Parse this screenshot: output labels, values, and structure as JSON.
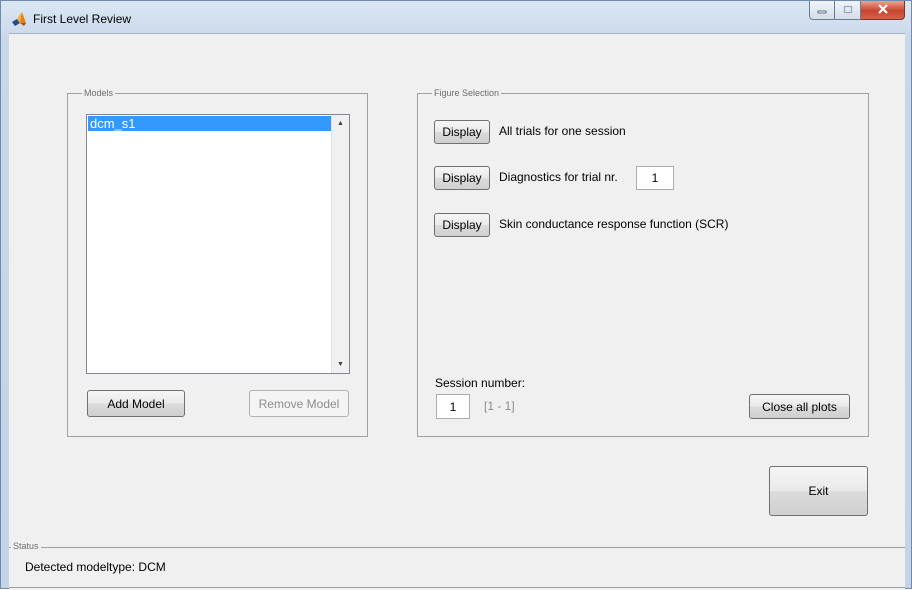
{
  "window": {
    "title": "First Level Review"
  },
  "models": {
    "legend": "Models",
    "items": [
      "dcm_s1"
    ],
    "add_label": "Add Model",
    "remove_label": "Remove Model"
  },
  "figure_selection": {
    "legend": "Figure Selection",
    "rows": [
      {
        "button": "Display",
        "text": "All trials for one session"
      },
      {
        "button": "Display",
        "text": "Diagnostics for trial nr.",
        "input_value": "1"
      },
      {
        "button": "Display",
        "text": "Skin conductance response function (SCR)"
      }
    ],
    "session_label": "Session number:",
    "session_value": "1",
    "session_range": "[1 - 1]",
    "close_all_label": "Close all plots"
  },
  "exit_label": "Exit",
  "status": {
    "legend": "Status",
    "text": "Detected modeltype: DCM"
  },
  "colors": {
    "selection": "#3399ff",
    "client_bg": "#f0f0f0",
    "close_button": "#c7452d"
  },
  "icons": [
    "matlab-icon",
    "minimize-icon",
    "maximize-icon",
    "close-icon",
    "scroll-up-icon",
    "scroll-down-icon"
  ]
}
